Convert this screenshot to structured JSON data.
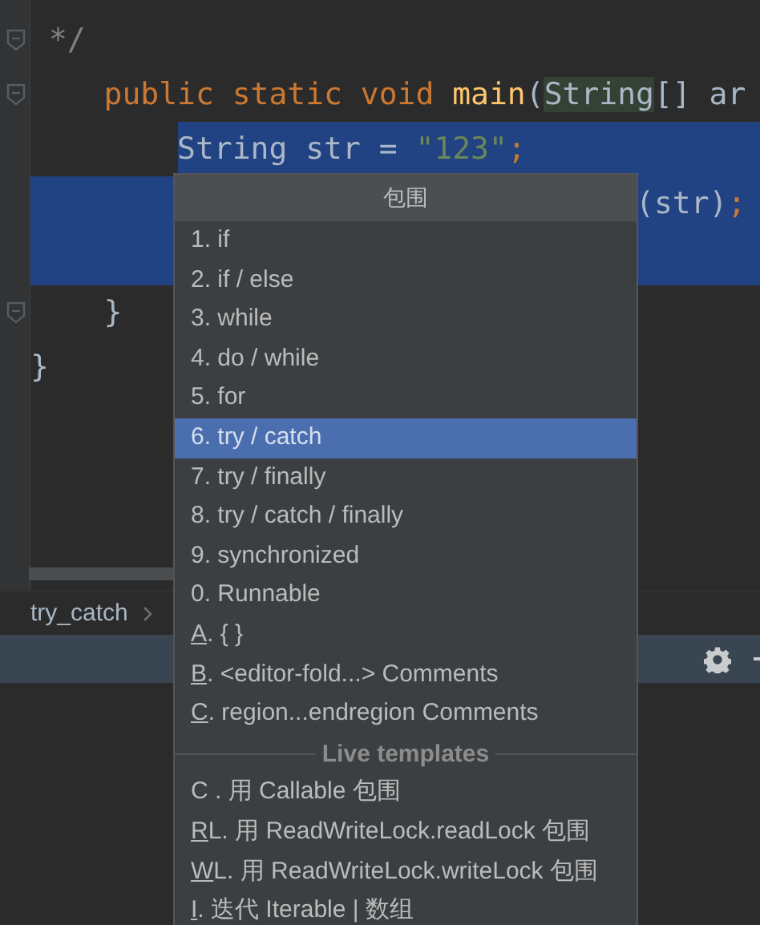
{
  "editor": {
    "lines": [
      {
        "selected": false,
        "fold": true,
        "tokens": [
          {
            "text": " */",
            "kind": "comment"
          }
        ]
      },
      {
        "selected": false,
        "fold": true,
        "tokens": [
          {
            "text": "    public static void ",
            "kind": "keyword"
          },
          {
            "text": "main",
            "kind": "function"
          },
          {
            "text": "(",
            "kind": "plain"
          },
          {
            "text": "String",
            "kind": "highlight"
          },
          {
            "text": "[] ar",
            "kind": "plain"
          }
        ]
      },
      {
        "selected": true,
        "fold": false,
        "tokens": [
          {
            "text": "        String str = ",
            "kind": "plain"
          },
          {
            "text": "\"123\"",
            "kind": "string"
          },
          {
            "text": ";",
            "kind": "keyword"
          }
        ]
      },
      {
        "selected": true,
        "fold": false,
        "tokens": [
          {
            "text": "                                 (str)",
            "kind": "plain"
          },
          {
            "text": ";",
            "kind": "keyword"
          }
        ]
      },
      {
        "selected": true,
        "fold": false
      },
      {
        "selected": false,
        "fold": true,
        "tokens": [
          {
            "text": "    }",
            "kind": "plain"
          }
        ]
      },
      {
        "selected": false,
        "fold": false,
        "tokens": [
          {
            "text": "}",
            "kind": "plain"
          }
        ]
      }
    ]
  },
  "breadcrumb": {
    "items": [
      "try_catch"
    ]
  },
  "popup": {
    "title": "包围",
    "items": [
      {
        "kind": "item",
        "text": "1. if",
        "selected": false
      },
      {
        "kind": "item",
        "text": "2. if / else",
        "selected": false
      },
      {
        "kind": "item",
        "text": "3. while",
        "selected": false
      },
      {
        "kind": "item",
        "text": "4. do / while",
        "selected": false
      },
      {
        "kind": "item",
        "text": "5. for",
        "selected": false
      },
      {
        "kind": "item",
        "text": "6. try / catch",
        "selected": true
      },
      {
        "kind": "item",
        "text": "7. try / finally",
        "selected": false
      },
      {
        "kind": "item",
        "text": "8. try / catch / finally",
        "selected": false
      },
      {
        "kind": "item",
        "text": "9. synchronized",
        "selected": false
      },
      {
        "kind": "item",
        "text": "0. Runnable",
        "selected": false
      },
      {
        "kind": "item",
        "underlined": "A",
        "text": ". { }",
        "selected": false
      },
      {
        "kind": "item",
        "underlined": "B",
        "text": ". <editor-fold...> Comments",
        "selected": false
      },
      {
        "kind": "item",
        "underlined": "C",
        "text": ". region...endregion Comments",
        "selected": false
      },
      {
        "kind": "separator",
        "text": "Live templates"
      },
      {
        "kind": "item",
        "text": "C . 用 Callable 包围",
        "selected": false
      },
      {
        "kind": "item",
        "underlined": "R",
        "text": "L. 用 ReadWriteLock.readLock 包围",
        "selected": false
      },
      {
        "kind": "item",
        "underlined": "W",
        "text": "L. 用 ReadWriteLock.writeLock 包围",
        "selected": false
      },
      {
        "kind": "item",
        "underlined": "I",
        "text": ". 迭代 Iterable | 数组",
        "selected": false
      }
    ]
  }
}
